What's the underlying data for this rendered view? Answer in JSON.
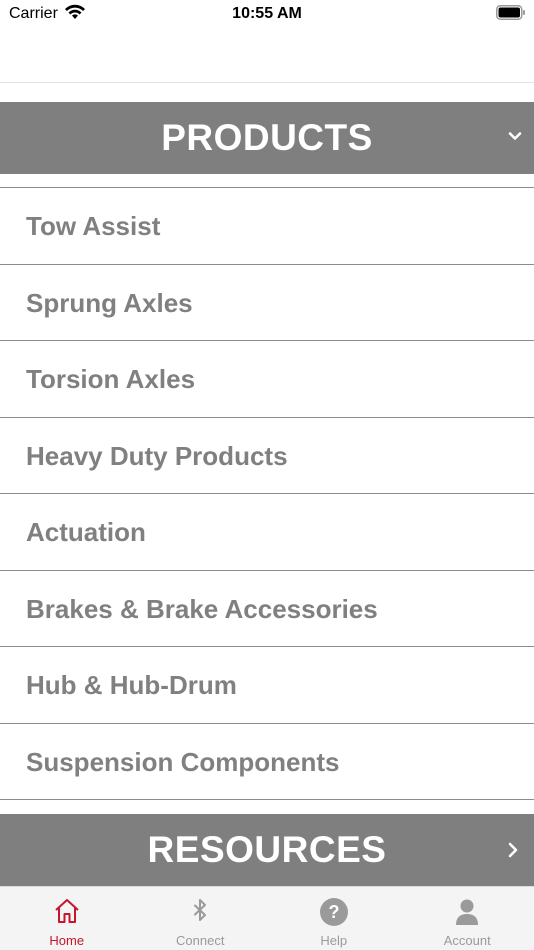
{
  "status_bar": {
    "carrier": "Carrier",
    "time": "10:55 AM"
  },
  "products_section": {
    "title": "PRODUCTS",
    "items": [
      {
        "label": "Tow Assist"
      },
      {
        "label": "Sprung Axles"
      },
      {
        "label": "Torsion Axles"
      },
      {
        "label": "Heavy Duty Products"
      },
      {
        "label": "Actuation"
      },
      {
        "label": "Brakes & Brake Accessories"
      },
      {
        "label": "Hub & Hub-Drum"
      },
      {
        "label": "Suspension Components"
      }
    ]
  },
  "resources_section": {
    "title": "RESOURCES"
  },
  "tab_bar": {
    "tabs": [
      {
        "label": "Home",
        "icon": "home-icon",
        "active": true
      },
      {
        "label": "Connect",
        "icon": "bluetooth-icon",
        "active": false
      },
      {
        "label": "Help",
        "icon": "help-icon",
        "active": false
      },
      {
        "label": "Account",
        "icon": "account-icon",
        "active": false
      }
    ]
  },
  "colors": {
    "header_bg": "#7f7f7f",
    "item_text": "#808080",
    "active_tab": "#c4162e",
    "inactive_tab": "#9a9a9a"
  }
}
